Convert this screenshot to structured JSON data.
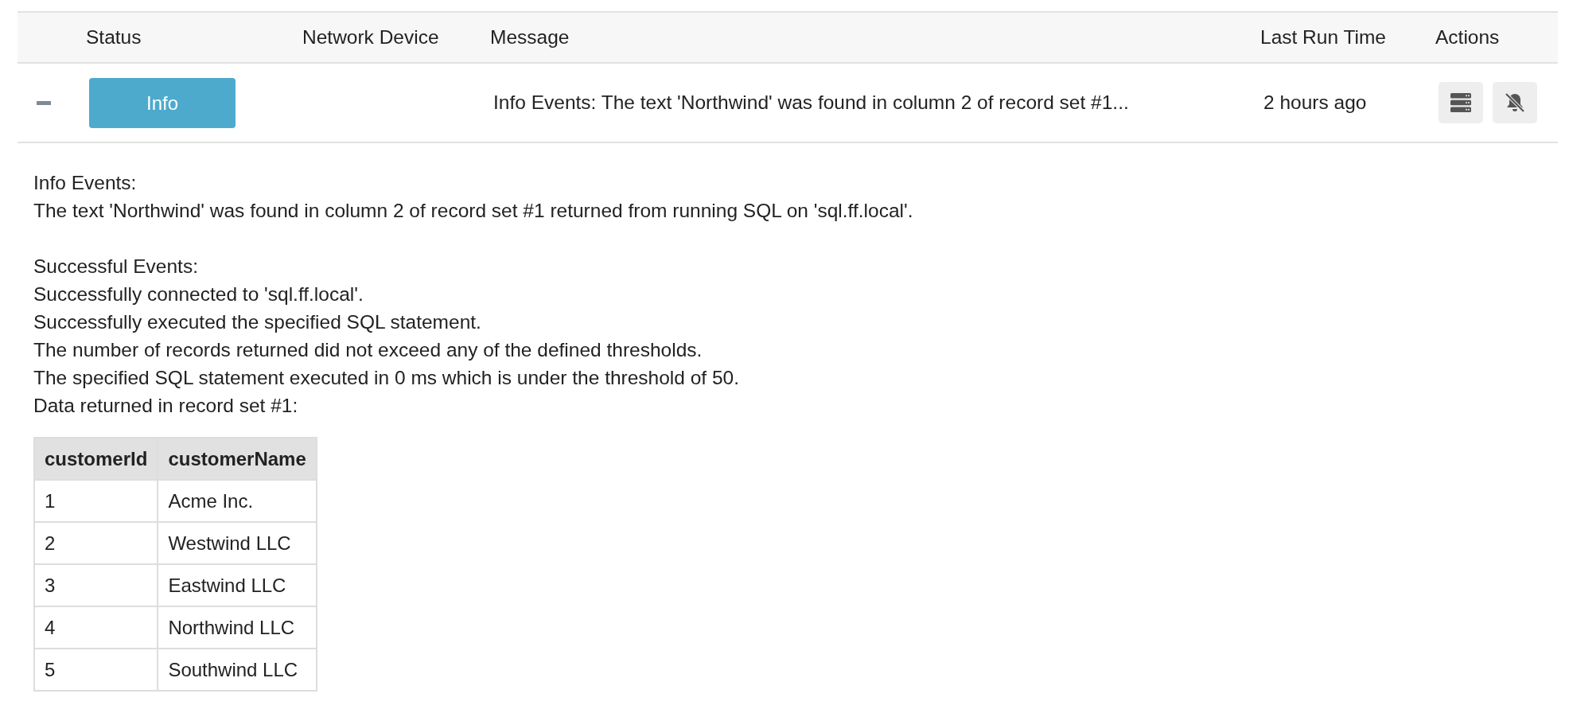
{
  "columns": [
    {
      "label": "Status"
    },
    {
      "label": "Network Device"
    },
    {
      "label": "Message"
    },
    {
      "label": "Last Run Time"
    },
    {
      "label": "Actions"
    }
  ],
  "rows": [
    {
      "expanded": true,
      "status": {
        "label": "Info",
        "kind": "info"
      },
      "network_device": "",
      "message": "Info Events: The text 'Northwind' was found in column 2 of record set #1...",
      "last_run_time": "2 hours ago",
      "actions": [
        {
          "kind": "server"
        },
        {
          "kind": "bell-off"
        }
      ],
      "details": {
        "sections": [
          {
            "lines": [
              "Info Events:",
              "The text 'Northwind' was found in column 2 of record set #1 returned from running SQL on 'sql.ff.local'."
            ]
          },
          {
            "lines": [
              "Successful Events:",
              "Successfully connected to 'sql.ff.local'.",
              "Successfully executed the specified SQL statement.",
              "The number of records returned did not exceed any of the defined thresholds.",
              "The specified SQL statement executed in 0 ms which is under the threshold of 50.",
              "Data returned in record set #1:"
            ]
          }
        ],
        "table": {
          "columns": [
            "customerId",
            "customerName"
          ],
          "rows": [
            [
              "1",
              "Acme Inc."
            ],
            [
              "2",
              "Westwind LLC"
            ],
            [
              "3",
              "Eastwind LLC"
            ],
            [
              "4",
              "Northwind LLC"
            ],
            [
              "5",
              "Southwind LLC"
            ]
          ]
        }
      }
    }
  ]
}
